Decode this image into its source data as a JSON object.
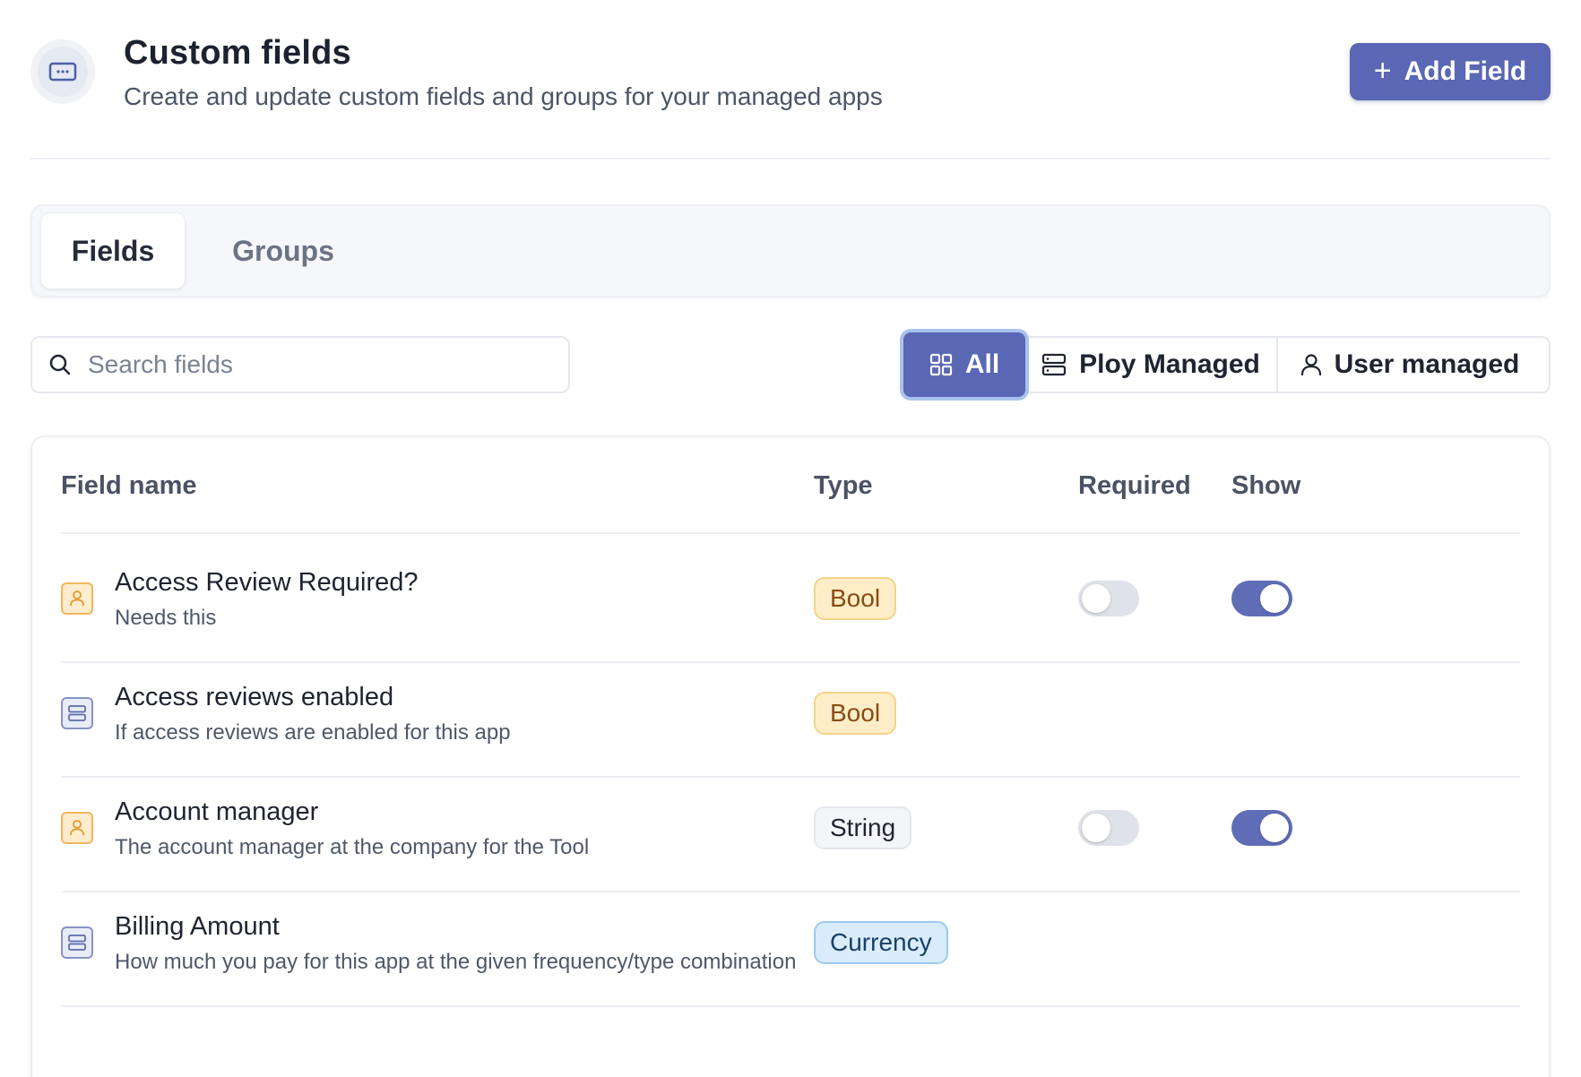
{
  "header": {
    "title": "Custom fields",
    "subtitle": "Create and update custom fields and groups for your managed apps",
    "icon": "form-input-icon",
    "add_button_label": "Add Field"
  },
  "tabs": [
    {
      "label": "Fields",
      "active": true
    },
    {
      "label": "Groups",
      "active": false
    }
  ],
  "search": {
    "placeholder": "Search fields",
    "value": ""
  },
  "filters": [
    {
      "label": "All",
      "icon": "grid-icon",
      "selected": true
    },
    {
      "label": "Ploy Managed",
      "icon": "server-icon",
      "selected": false
    },
    {
      "label": "User managed",
      "icon": "user-icon",
      "selected": false
    }
  ],
  "table": {
    "columns": [
      "Field name",
      "Type",
      "Required",
      "Show"
    ],
    "rows": [
      {
        "name": "Access Review Required?",
        "description": "Needs this",
        "source": "user",
        "type": "Bool",
        "required": false,
        "show": true,
        "has_toggles": true
      },
      {
        "name": "Access reviews enabled",
        "description": "If access reviews are enabled for this app",
        "source": "ploy",
        "type": "Bool",
        "has_toggles": false
      },
      {
        "name": "Account manager",
        "description": "The account manager at the company for the Tool",
        "source": "user",
        "type": "String",
        "required": false,
        "show": true,
        "has_toggles": true
      },
      {
        "name": "Billing Amount",
        "description": "How much you pay for this app at the given frequency/type combination",
        "source": "ploy",
        "type": "Currency",
        "has_toggles": false
      }
    ]
  },
  "colors": {
    "accent": "#5a67b4",
    "toggle_on": "#5f6db7",
    "bool_badge_bg": "#fdeec8",
    "currency_badge_bg": "#d9ecfb",
    "user_icon_border": "#f2b65c"
  }
}
